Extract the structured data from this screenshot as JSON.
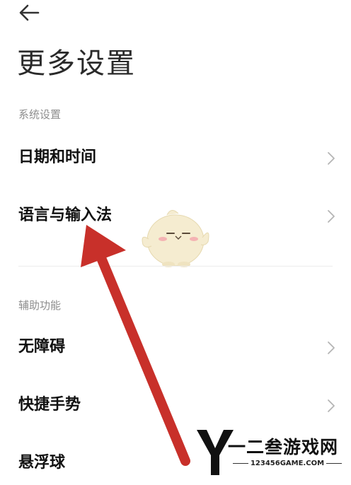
{
  "header": {
    "title": "更多设置"
  },
  "icons": {
    "back": "back-arrow-icon",
    "chevron": "chevron-right-icon"
  },
  "sections": [
    {
      "title": "系统设置",
      "items": [
        {
          "label": "日期和时间"
        },
        {
          "label": "语言与输入法"
        }
      ]
    },
    {
      "title": "辅助功能",
      "items": [
        {
          "label": "无障碍"
        },
        {
          "label": "快捷手势"
        },
        {
          "label": "悬浮球"
        }
      ]
    }
  ],
  "colors": {
    "annotation_arrow": "#c8302a",
    "section_title": "#8e8e8e",
    "item_text": "#111111",
    "chevron": "#b5b5b5"
  },
  "watermark": {
    "brand": "一二叁游戏网",
    "url": "123456GAME.COM"
  }
}
